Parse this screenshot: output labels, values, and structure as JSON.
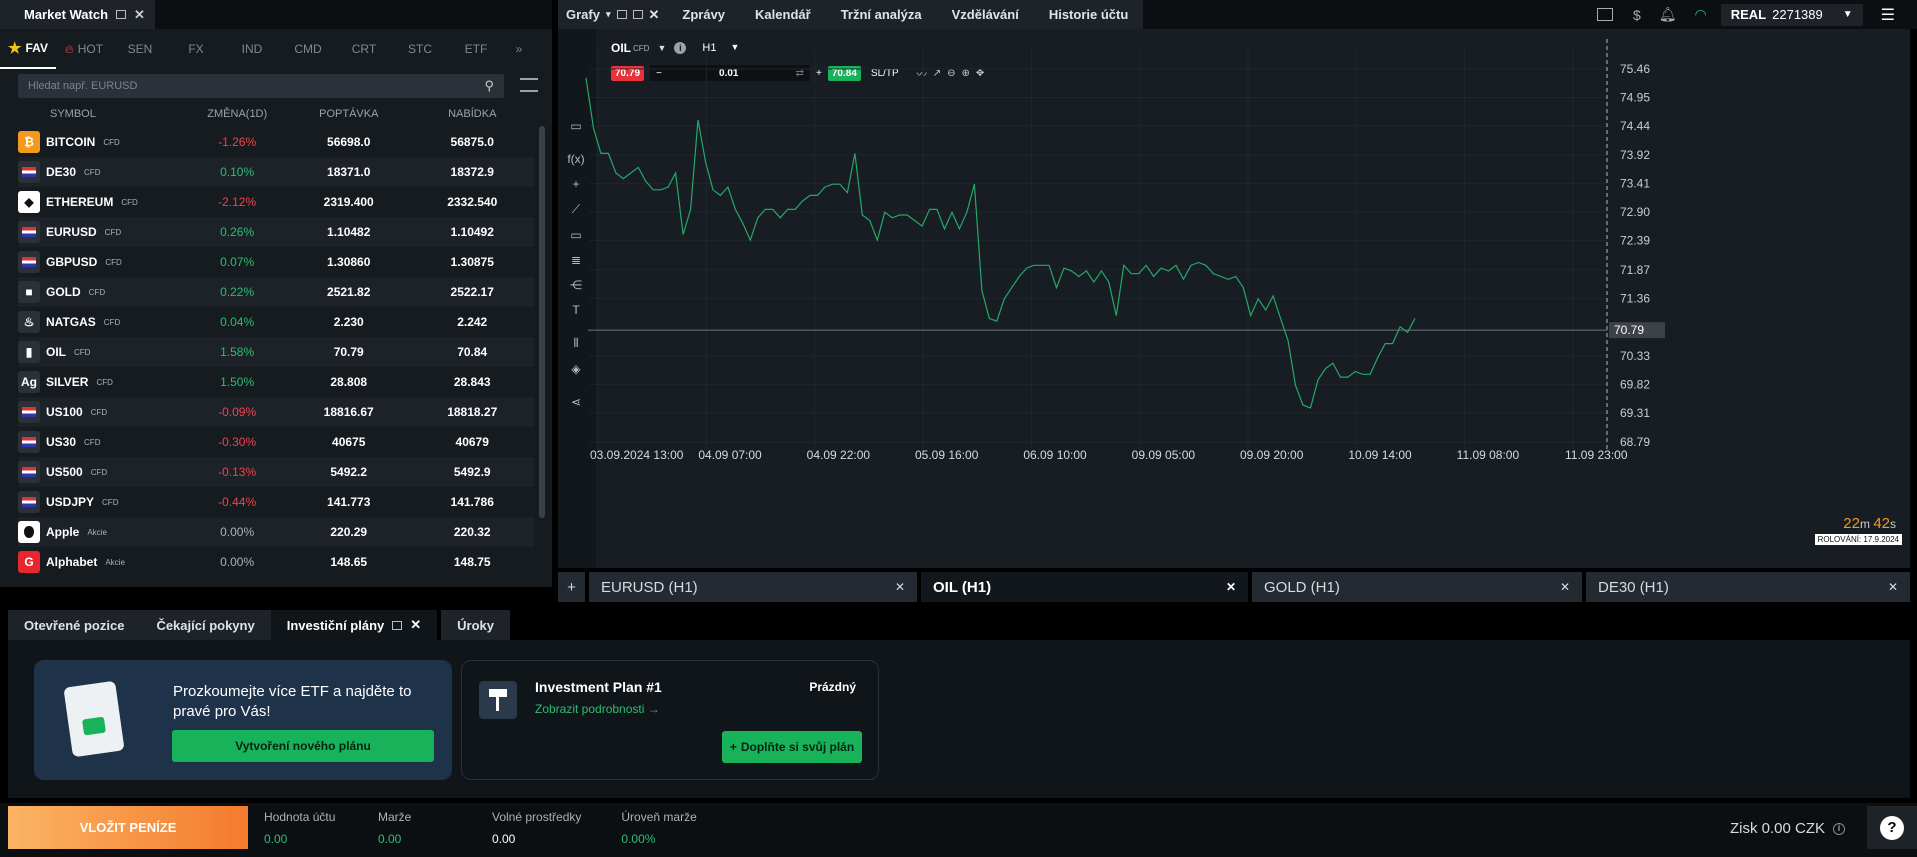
{
  "market_watch": {
    "title": "Market Watch",
    "tabs": [
      "FAV",
      "HOT",
      "SEN",
      "FX",
      "IND",
      "CMD",
      "CRT",
      "STC",
      "ETF"
    ],
    "search_placeholder": "Hledat např. EURUSD",
    "columns": {
      "symbol": "SYMBOL",
      "change": "ZMĚNA(1D)",
      "ask": "POPTÁVKA",
      "bid": "NABÍDKA"
    },
    "rows": [
      {
        "symbol": "BITCOIN",
        "type": "CFD",
        "change": "-1.26%",
        "ask": "56698.0",
        "bid": "56875.0",
        "dir": "neg",
        "icon": "₿",
        "color": "#f39a1c"
      },
      {
        "symbol": "DE30",
        "type": "CFD",
        "change": "0.10%",
        "ask": "18371.0",
        "bid": "18372.9",
        "dir": "pos",
        "icon": "de",
        "color": "#2a3138"
      },
      {
        "symbol": "ETHEREUM",
        "type": "CFD",
        "change": "-2.12%",
        "ask": "2319.400",
        "bid": "2332.540",
        "dir": "neg",
        "icon": "◆",
        "color": "#ffffff"
      },
      {
        "symbol": "EURUSD",
        "type": "CFD",
        "change": "0.26%",
        "ask": "1.10482",
        "bid": "1.10492",
        "dir": "pos",
        "icon": "us",
        "color": "#2a3138"
      },
      {
        "symbol": "GBPUSD",
        "type": "CFD",
        "change": "0.07%",
        "ask": "1.30860",
        "bid": "1.30875",
        "dir": "pos",
        "icon": "gb",
        "color": "#2a3138"
      },
      {
        "symbol": "GOLD",
        "type": "CFD",
        "change": "0.22%",
        "ask": "2521.82",
        "bid": "2522.17",
        "dir": "pos",
        "icon": "■",
        "color": "#2a3138"
      },
      {
        "symbol": "NATGAS",
        "type": "CFD",
        "change": "0.04%",
        "ask": "2.230",
        "bid": "2.242",
        "dir": "pos",
        "icon": "♨",
        "color": "#2a3138"
      },
      {
        "symbol": "OIL",
        "type": "CFD",
        "change": "1.58%",
        "ask": "70.79",
        "bid": "70.84",
        "dir": "pos",
        "icon": "▮",
        "color": "#2a3138"
      },
      {
        "symbol": "SILVER",
        "type": "CFD",
        "change": "1.50%",
        "ask": "28.808",
        "bid": "28.843",
        "dir": "pos",
        "icon": "Ag",
        "color": "#2a3138"
      },
      {
        "symbol": "US100",
        "type": "CFD",
        "change": "-0.09%",
        "ask": "18816.67",
        "bid": "18818.27",
        "dir": "neg",
        "icon": "us",
        "color": "#2a3138"
      },
      {
        "symbol": "US30",
        "type": "CFD",
        "change": "-0.30%",
        "ask": "40675",
        "bid": "40679",
        "dir": "neg",
        "icon": "us",
        "color": "#2a3138"
      },
      {
        "symbol": "US500",
        "type": "CFD",
        "change": "-0.13%",
        "ask": "5492.2",
        "bid": "5492.9",
        "dir": "neg",
        "icon": "us",
        "color": "#2a3138"
      },
      {
        "symbol": "USDJPY",
        "type": "CFD",
        "change": "-0.44%",
        "ask": "141.773",
        "bid": "141.786",
        "dir": "neg",
        "icon": "us",
        "color": "#2a3138"
      },
      {
        "symbol": "Apple",
        "type": "Akcie",
        "change": "0.00%",
        "ask": "220.29",
        "bid": "220.32",
        "dir": "zero",
        "icon": "",
        "color": "#ffffff"
      },
      {
        "symbol": "Alphabet",
        "type": "Akcie",
        "change": "0.00%",
        "ask": "148.65",
        "bid": "148.75",
        "dir": "zero",
        "icon": "G",
        "color": "#e8262f"
      }
    ]
  },
  "top_nav": {
    "grafy": "Grafy",
    "tabs": [
      "Zprávy",
      "Kalendář",
      "Tržní analýza",
      "Vzdělávání",
      "Historie účtu"
    ],
    "account": "REAL",
    "account_number": "2271389"
  },
  "chart_toolbar": {
    "symbol": "OIL",
    "symbol_type": "CFD",
    "timeframe": "H1",
    "sell_price": "70.79",
    "volume": "0.01",
    "buy_price": "70.84",
    "sltp": "SL/TP"
  },
  "chart_data": {
    "type": "line",
    "x_ticks": [
      "03.09.2024 13:00",
      "04.09 07:00",
      "04.09 22:00",
      "05.09 16:00",
      "06.09 10:00",
      "09.09 05:00",
      "09.09 20:00",
      "10.09 14:00",
      "11.09 08:00",
      "11.09 23:00"
    ],
    "y_ticks": [
      75.46,
      74.95,
      74.44,
      73.92,
      73.41,
      72.9,
      72.39,
      71.87,
      71.36,
      70.33,
      69.82,
      69.31,
      68.79
    ],
    "ylim": [
      68.79,
      75.46
    ],
    "current_price": "70.79",
    "countdown_min": "22",
    "countdown_sec": "42",
    "rollover": "ROLOVÁNÍ: 17.9.2024",
    "values": [
      75.3,
      74.4,
      73.95,
      73.95,
      73.6,
      73.5,
      73.6,
      73.7,
      73.45,
      73.3,
      73.3,
      73.35,
      73.6,
      72.5,
      72.95,
      74.55,
      73.8,
      73.3,
      73.2,
      73.35,
      72.95,
      72.7,
      72.4,
      72.8,
      72.95,
      72.95,
      72.8,
      72.95,
      72.95,
      73.1,
      73.2,
      73.2,
      73.35,
      73.4,
      73.4,
      73.25,
      73.95,
      72.85,
      72.75,
      72.4,
      72.9,
      72.8,
      72.85,
      72.85,
      72.75,
      72.65,
      72.95,
      72.95,
      72.6,
      72.9,
      72.6,
      72.9,
      73.4,
      71.5,
      71.0,
      70.95,
      71.35,
      71.55,
      71.75,
      71.9,
      71.95,
      71.95,
      71.95,
      71.55,
      71.9,
      71.85,
      71.75,
      71.85,
      71.65,
      71.85,
      71.65,
      71.05,
      71.95,
      71.8,
      71.8,
      71.95,
      71.75,
      71.9,
      71.85,
      71.95,
      71.7,
      71.95,
      72.0,
      71.95,
      71.8,
      71.75,
      71.7,
      71.75,
      71.55,
      71.05,
      71.35,
      71.15,
      71.4,
      71.0,
      70.6,
      69.8,
      69.45,
      69.4,
      69.9,
      70.1,
      70.2,
      69.95,
      69.95,
      70.05,
      70.0,
      70.0,
      70.3,
      70.55,
      70.55,
      70.85,
      70.75,
      71.0
    ]
  },
  "chart_tabs": [
    {
      "label": "EURUSD (H1)",
      "active": false
    },
    {
      "label": "OIL (H1)",
      "active": true
    },
    {
      "label": "GOLD (H1)",
      "active": false
    },
    {
      "label": "DE30 (H1)",
      "active": false
    }
  ],
  "bottom_tabs": [
    "Otevřené pozice",
    "Čekající pokyny",
    "Investiční plány",
    "Úroky"
  ],
  "promo": {
    "text": "Prozkoumejte více ETF a najděte to pravé pro Vás!",
    "button": "Vytvoření nového plánu"
  },
  "plan": {
    "title": "Investment Plan #1",
    "status": "Prázdný",
    "details": "Zobrazit podrobnosti →",
    "button": "Doplňte si svůj plán"
  },
  "footer": {
    "deposit": "VLOŽIT PENÍZE",
    "stats": [
      {
        "label": "Hodnota účtu",
        "value": "0.00",
        "green": true
      },
      {
        "label": "Marže",
        "value": "0.00",
        "green": true
      },
      {
        "label": "Volné prostředky",
        "value": "0.00",
        "green": false
      },
      {
        "label": "Úroveň marže",
        "value": "0.00%",
        "green": true
      }
    ],
    "profit": "Zisk 0.00 CZK"
  },
  "colors": {
    "green": "#2bbf71",
    "red": "#f2424a",
    "accent_orange": "#f39a1c",
    "chart_line": "#25a868"
  }
}
